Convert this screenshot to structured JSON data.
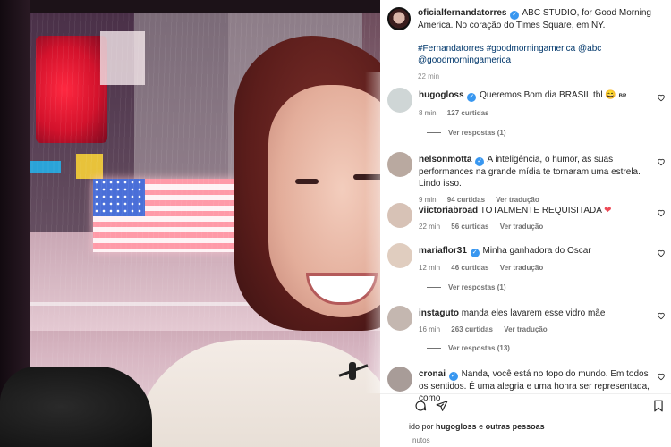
{
  "post": {
    "username": "oficialfernandatorres",
    "caption": "ABC STUDIO, for Good Morning America. No coração do Times Square, em NY.",
    "hashtags": "#Fernandatorres #goodmorningamerica @abc @goodmorningamerica",
    "time": "22 min"
  },
  "comments": [
    {
      "username": "hugogloss",
      "verified": true,
      "text": "Queremos Bom dia BRASIL tbl 😄",
      "suffix": "BR",
      "time": "8 min",
      "likes": "127 curtidas",
      "translate": "",
      "replies": "Ver respostas (1)"
    },
    {
      "username": "nelsonmotta",
      "verified": true,
      "text": "A inteligência, o humor, as suas performances na grande mídia te tornaram uma estrela. Lindo isso.",
      "time": "9 min",
      "likes": "94 curtidas",
      "translate": "Ver tradução",
      "replies": ""
    },
    {
      "username": "viictoriabroad",
      "verified": false,
      "text": "TOTALMENTE REQUISITADA",
      "heart": "❤",
      "time": "22 min",
      "likes": "56 curtidas",
      "translate": "Ver tradução",
      "replies": ""
    },
    {
      "username": "mariaflor31",
      "verified": true,
      "text": "Minha ganhadora do Oscar",
      "time": "12 min",
      "likes": "46 curtidas",
      "translate": "Ver tradução",
      "replies": "Ver respostas (1)"
    },
    {
      "username": "instaguto",
      "verified": false,
      "text": "manda eles lavarem esse vidro mãe",
      "time": "16 min",
      "likes": "263 curtidas",
      "translate": "Ver tradução",
      "replies": "Ver respostas (13)"
    },
    {
      "username": "cronai",
      "verified": true,
      "text": "Nanda, você está no topo do mundo. Em todos os sentidos. É uma alegria e uma honra ser representada, como",
      "time": "",
      "likes": "",
      "translate": "",
      "replies": ""
    }
  ],
  "footer": {
    "likes_prefix": "ido por",
    "likes_user": "hugogloss",
    "likes_joiner": "e",
    "likes_others": "outras pessoas",
    "time": "nutos"
  },
  "icons": {
    "verified": "verified-badge-icon",
    "like": "heart-outline-icon",
    "comment": "comment-icon",
    "share": "paper-plane-icon",
    "save": "bookmark-icon"
  },
  "colors": {
    "verified_blue": "#3897f0",
    "link_blue": "#00376b",
    "muted": "#737373",
    "heart_red": "#ed4956"
  }
}
